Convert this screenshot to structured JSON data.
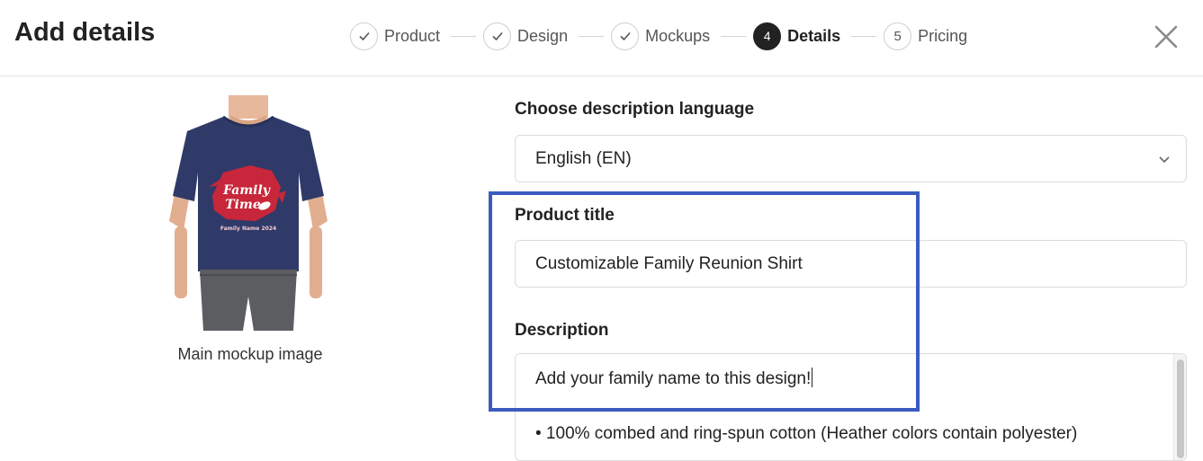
{
  "header": {
    "title": "Add details",
    "steps": [
      {
        "label": "Product",
        "state": "done",
        "icon": "check-icon"
      },
      {
        "label": "Design",
        "state": "done",
        "icon": "check-icon"
      },
      {
        "label": "Mockups",
        "state": "done",
        "icon": "check-icon"
      },
      {
        "label": "Details",
        "state": "active",
        "number": "4"
      },
      {
        "label": "Pricing",
        "state": "upcoming",
        "number": "5"
      }
    ],
    "close_icon": "close-icon"
  },
  "mockup": {
    "caption": "Main mockup image",
    "shirt_text_line1": "Family",
    "shirt_text_line2": "Time",
    "shirt_text_line3": "Family Name 2024",
    "shirt_color": "#2f3a68",
    "graphic_color": "#c8263a"
  },
  "form": {
    "language_label": "Choose description language",
    "language_value": "English (EN)",
    "title_label": "Product title",
    "title_value": "Customizable Family Reunion Shirt",
    "description_label": "Description",
    "description_line1": "Add your family name to this design!",
    "description_line2": "• 100% combed and ring-spun cotton (Heather colors contain polyester)"
  },
  "colors": {
    "highlight": "#3b5bbf",
    "active_step": "#222222"
  }
}
